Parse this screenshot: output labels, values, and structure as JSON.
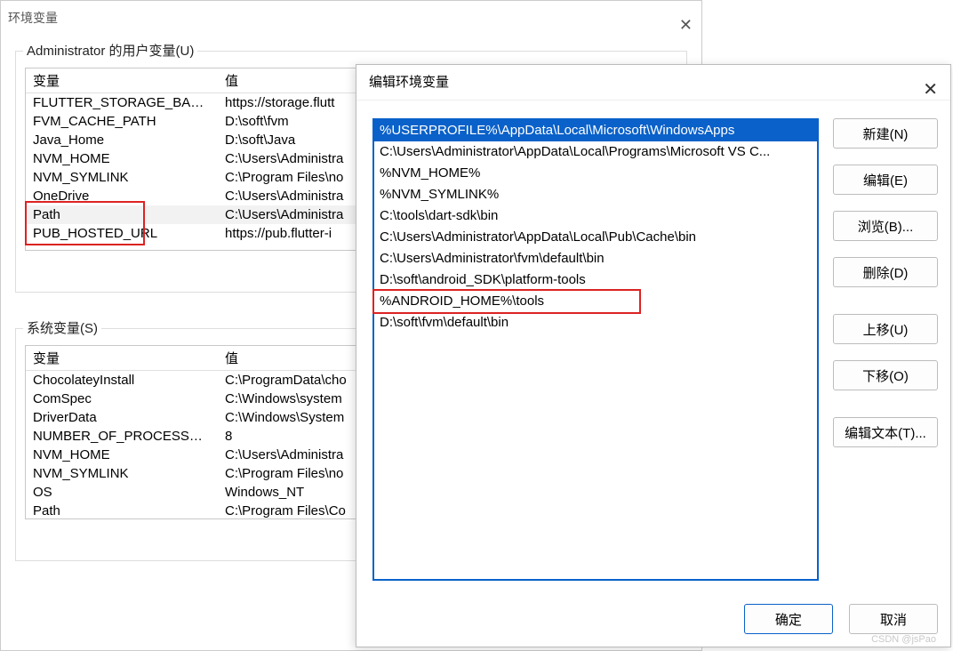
{
  "backDialog": {
    "title": "环境变量",
    "userGroupLabel": "Administrator 的用户变量(U)",
    "sysGroupLabel": "系统变量(S)",
    "colVariable": "变量",
    "colValue": "值",
    "userVars": [
      {
        "name": "FLUTTER_STORAGE_BASE_...",
        "value": "https://storage.flutt"
      },
      {
        "name": "FVM_CACHE_PATH",
        "value": "D:\\soft\\fvm"
      },
      {
        "name": "Java_Home",
        "value": "D:\\soft\\Java"
      },
      {
        "name": "NVM_HOME",
        "value": "C:\\Users\\Administra"
      },
      {
        "name": "NVM_SYMLINK",
        "value": "C:\\Program Files\\no"
      },
      {
        "name": "OneDrive",
        "value": "C:\\Users\\Administra"
      },
      {
        "name": "Path",
        "value": "C:\\Users\\Administra"
      },
      {
        "name": "PUB_HOSTED_URL",
        "value": "https://pub.flutter-i"
      }
    ],
    "sysVars": [
      {
        "name": "ChocolateyInstall",
        "value": "C:\\ProgramData\\cho"
      },
      {
        "name": "ComSpec",
        "value": "C:\\Windows\\system"
      },
      {
        "name": "DriverData",
        "value": "C:\\Windows\\System"
      },
      {
        "name": "NUMBER_OF_PROCESSORS",
        "value": "8"
      },
      {
        "name": "NVM_HOME",
        "value": "C:\\Users\\Administra"
      },
      {
        "name": "NVM_SYMLINK",
        "value": "C:\\Program Files\\no"
      },
      {
        "name": "OS",
        "value": "Windows_NT"
      },
      {
        "name": "Path",
        "value": "C:\\Program Files\\Co"
      }
    ]
  },
  "frontDialog": {
    "title": "编辑环境变量",
    "items": [
      "%USERPROFILE%\\AppData\\Local\\Microsoft\\WindowsApps",
      "C:\\Users\\Administrator\\AppData\\Local\\Programs\\Microsoft VS C...",
      "%NVM_HOME%",
      "%NVM_SYMLINK%",
      "C:\\tools\\dart-sdk\\bin",
      "C:\\Users\\Administrator\\AppData\\Local\\Pub\\Cache\\bin",
      "C:\\Users\\Administrator\\fvm\\default\\bin",
      "D:\\soft\\android_SDK\\platform-tools",
      "%ANDROID_HOME%\\tools",
      "D:\\soft\\fvm\\default\\bin"
    ],
    "buttons": {
      "new": "新建(N)",
      "edit": "编辑(E)",
      "browse": "浏览(B)...",
      "delete": "删除(D)",
      "moveUp": "上移(U)",
      "moveDown": "下移(O)",
      "editText": "编辑文本(T)...",
      "ok": "确定",
      "cancel": "取消"
    }
  },
  "watermark": "CSDN @jsPao"
}
